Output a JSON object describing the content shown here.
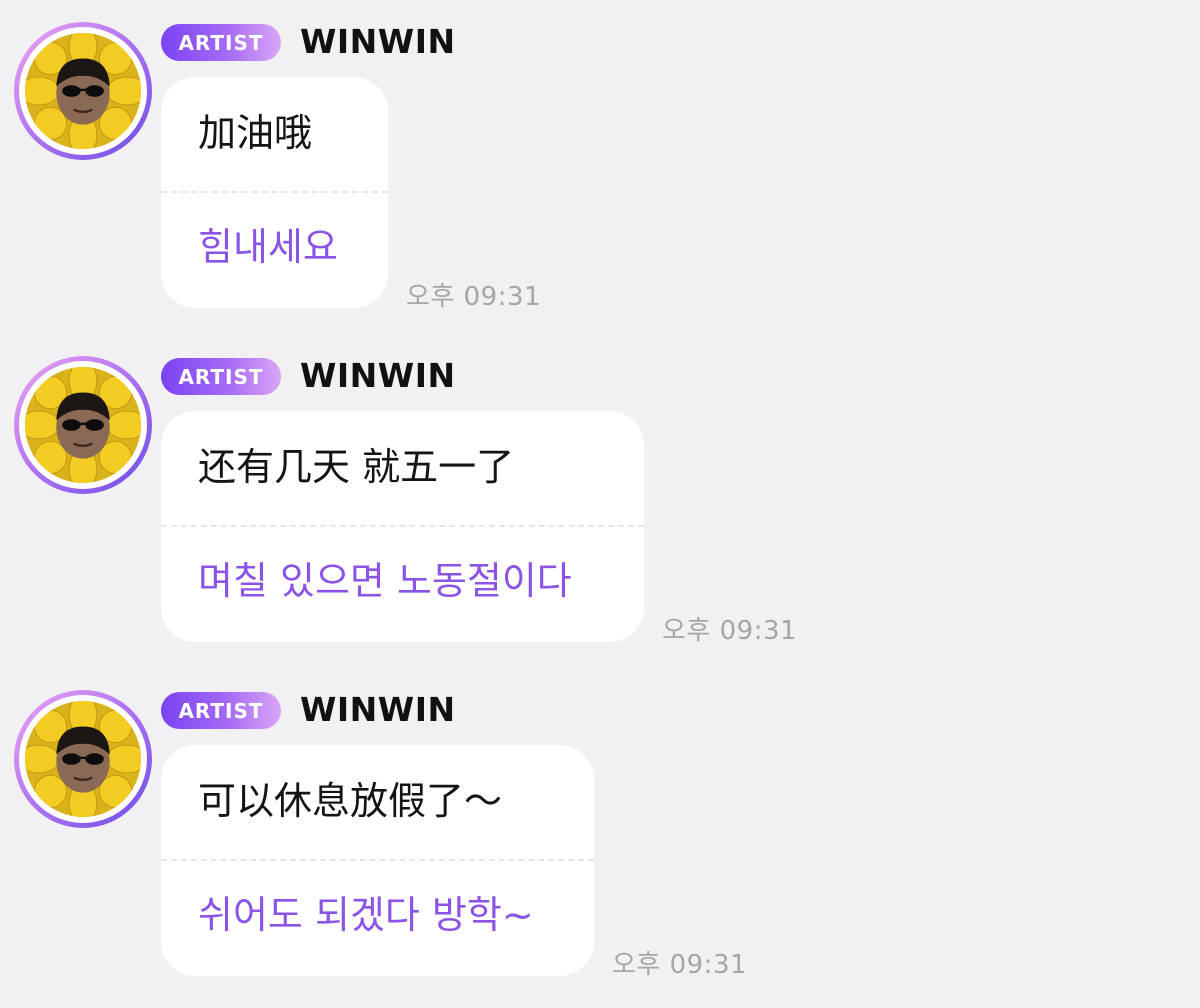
{
  "messages": [
    {
      "badge": "ARTIST",
      "sender": "WINWIN",
      "original": "加油哦",
      "translation": "힘내세요",
      "time": "오후 09:31"
    },
    {
      "badge": "ARTIST",
      "sender": "WINWIN",
      "original": "还有几天 就五一了",
      "translation": "며칠 있으면 노동절이다",
      "time": "오후 09:31"
    },
    {
      "badge": "ARTIST",
      "sender": "WINWIN",
      "original": "可以休息放假了～",
      "translation": "쉬어도 되겠다 방학~",
      "time": "오후 09:31"
    }
  ],
  "icons": {
    "avatar": "sunflower-profile-photo"
  },
  "colors": {
    "background": "#f1f1f3",
    "bubble": "#ffffff",
    "translation_text": "#8b53e6",
    "badge_start": "#7a43f2",
    "badge_end": "#d9a6f6",
    "timestamp_text": "#a5a5aa"
  }
}
